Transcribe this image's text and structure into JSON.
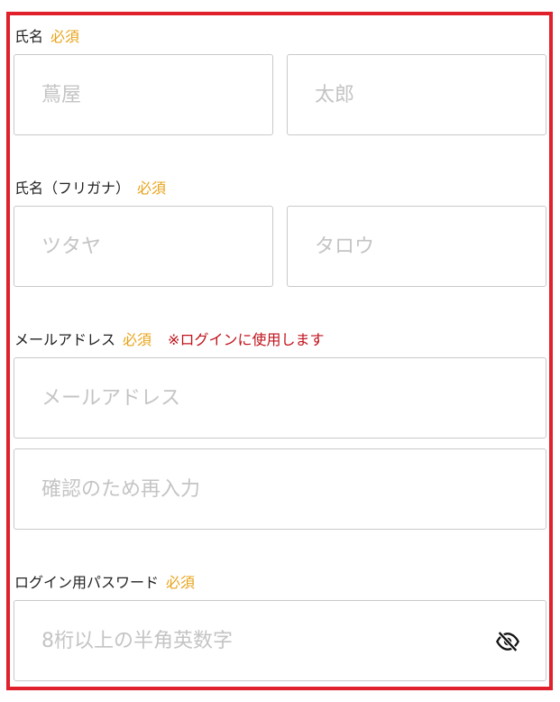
{
  "name": {
    "label": "氏名",
    "required": "必須",
    "last_placeholder": "蔦屋",
    "first_placeholder": "太郎"
  },
  "kana": {
    "label": "氏名（フリガナ）",
    "required": "必須",
    "last_placeholder": "ツタヤ",
    "first_placeholder": "タロウ"
  },
  "email": {
    "label": "メールアドレス",
    "required": "必須",
    "note": "※ログインに使用します",
    "placeholder": "メールアドレス",
    "confirm_placeholder": "確認のため再入力"
  },
  "password": {
    "label": "ログイン用パスワード",
    "required": "必須",
    "placeholder": "8桁以上の半角英数字",
    "toggle_icon": "eye-slash-icon"
  },
  "colors": {
    "frame": "#e0202b",
    "required": "#e8a319",
    "note": "#c0121b"
  }
}
